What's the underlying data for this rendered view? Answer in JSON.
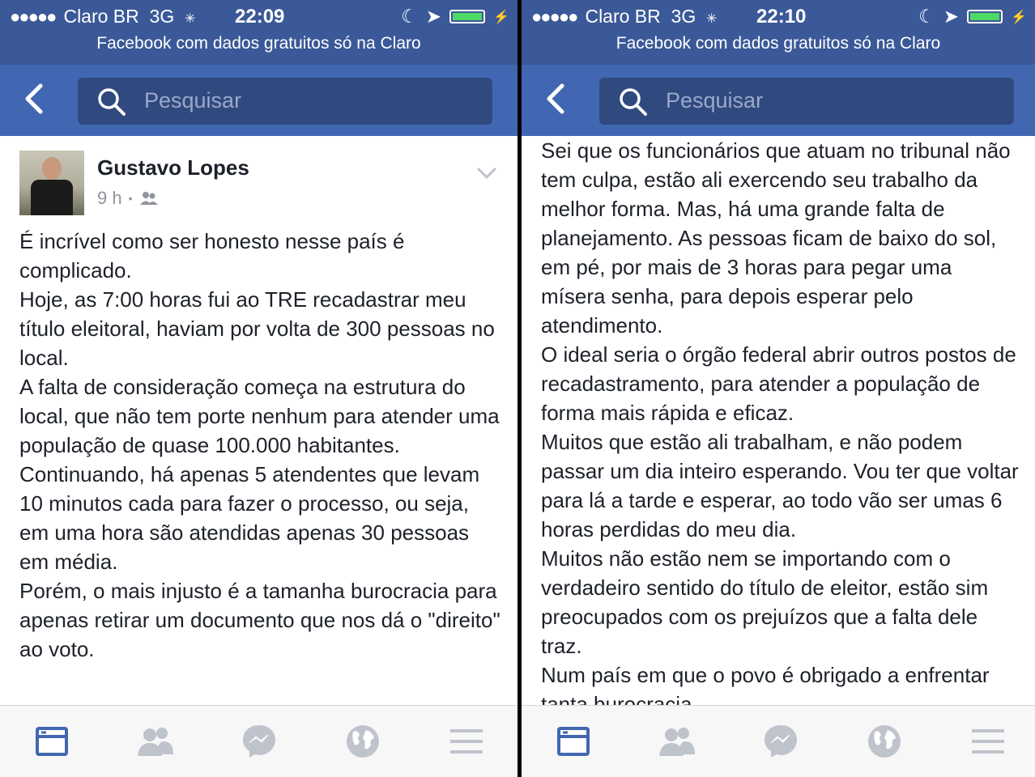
{
  "panels": [
    {
      "status": {
        "carrier": "Claro BR",
        "network": "3G",
        "time": "22:09"
      },
      "banner": "Facebook com dados gratuitos só na Claro",
      "search": {
        "placeholder": "Pesquisar"
      },
      "post": {
        "author": "Gustavo Lopes",
        "time": "9 h",
        "body": "É incrível como ser honesto nesse país é complicado.\nHoje, as 7:00 horas fui ao TRE recadastrar meu título eleitoral, haviam por volta de 300 pessoas no local.\nA falta de consideração começa na estrutura do local, que não tem porte nenhum para atender uma população de quase 100.000 habitantes. Continuando, há apenas 5 atendentes que levam 10 minutos cada para fazer o processo, ou seja, em uma hora são atendidas apenas 30 pessoas em média.\nPorém, o mais injusto é a tamanha burocracia para apenas retirar um documento que nos dá o \"direito\" ao voto."
      }
    },
    {
      "status": {
        "carrier": "Claro BR",
        "network": "3G",
        "time": "22:10"
      },
      "banner": "Facebook com dados gratuitos só na Claro",
      "search": {
        "placeholder": "Pesquisar"
      },
      "post": {
        "body": "dá o \"direito\" ao voto.\nSei que os funcionários que atuam no tribunal não tem culpa, estão ali exercendo seu trabalho da melhor forma. Mas, há uma grande falta de planejamento. As pessoas ficam de baixo do sol, em pé, por mais de 3 horas para pegar uma mísera senha, para depois esperar pelo atendimento.\nO ideal seria o órgão federal abrir outros postos de recadastramento, para atender a população de forma mais rápida e eficaz.\nMuitos que estão ali trabalham, e não podem passar um dia inteiro esperando. Vou ter que voltar para lá a tarde e esperar, ao todo vão ser umas 6 horas perdidas do meu dia.\nMuitos não estão nem se importando com o verdadeiro sentido do título de eleitor, estão sim preocupados com os prejuízos que a falta dele traz.\nNum país em que o povo é obrigado a enfrentar tanta burocracia"
      }
    }
  ],
  "colors": {
    "header": "#3b5998",
    "navbar": "#4267b2",
    "active_tab": "#4267b2",
    "inactive_tab": "#bfc3cc"
  },
  "tabs": [
    "news-feed-icon",
    "friends-icon",
    "messenger-icon",
    "globe-icon",
    "menu-icon"
  ]
}
